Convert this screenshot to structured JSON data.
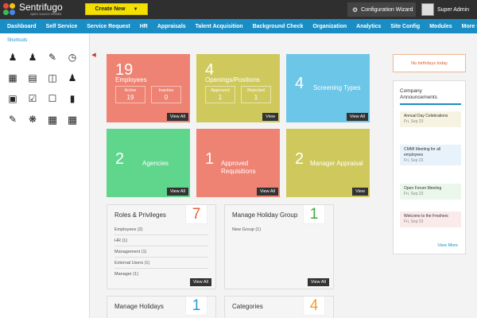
{
  "app": {
    "name": "Sentrifugo",
    "tagline": "open source HRMS",
    "create_label": "Create New",
    "config_label": "Configuration Wizard",
    "user_label": "Super Admin"
  },
  "nav": [
    "Dashboard",
    "Self Service",
    "Service Request",
    "HR",
    "Appraisals",
    "Talent Acquisition",
    "Background Check",
    "Organization",
    "Analytics",
    "Site Config",
    "Modules",
    "More ▾"
  ],
  "sidebar": {
    "title": "Shortcuts",
    "icons": [
      "user-add-icon",
      "user-settings-icon",
      "user-edit-icon",
      "schedule-icon",
      "calendar-icon",
      "document-list-icon",
      "id-card-icon",
      "team-icon",
      "monitor-check-icon",
      "checklist-icon",
      "file-check-icon",
      "ruler-icon",
      "form-edit-icon",
      "gear-icon",
      "grid-icon",
      "grid-icon-2"
    ]
  },
  "tiles": {
    "employees": {
      "count": "19",
      "label": "Employees",
      "active_label": "Active",
      "active_value": "19",
      "inactive_label": "Inactive",
      "inactive_value": "0",
      "action": "View All",
      "color": "#ee8273"
    },
    "openings": {
      "count": "4",
      "label": "Openings/Positions",
      "approved_label": "Approved",
      "approved_value": "1",
      "rejected_label": "Rejected",
      "rejected_value": "1",
      "action": "View",
      "color": "#cfc95d"
    },
    "screening": {
      "count": "4",
      "label": "Screening Types",
      "action": "View All",
      "color": "#6cc6e8"
    },
    "agencies": {
      "count": "2",
      "label": "Agencies",
      "action": "View All",
      "color": "#5fd68c"
    },
    "requisitions": {
      "count": "1",
      "label_line1": "Approved",
      "label_line2": "Requisitions",
      "action": "View All",
      "color": "#ee8273"
    },
    "appraisal": {
      "count": "2",
      "label": "Manager Appraisal",
      "action": "View",
      "color": "#cfc95d"
    }
  },
  "panels": {
    "roles": {
      "title": "Roles & Privileges",
      "count": "7",
      "count_color": "#e8603c",
      "items": [
        "Employees (2)",
        "HR (1)",
        "Management (1)",
        "External Users (1)",
        "Manager (1)"
      ],
      "action": "View All"
    },
    "holiday_group": {
      "title": "Manage Holiday Group",
      "count": "1",
      "count_color": "#3fa842",
      "items": [
        "New Group (1)"
      ],
      "action": "View All"
    },
    "holidays": {
      "title": "Manage Holidays",
      "count": "1",
      "count_color": "#2a9fd8"
    },
    "categories": {
      "title": "Categories",
      "count": "4",
      "count_color": "#f0a030"
    }
  },
  "right": {
    "birthday_text": "No birthdays today",
    "announcements_title": "Company Announcements",
    "announcements": [
      {
        "title": "Annual Day Celebrations",
        "date": "Fri, Sep 23",
        "bg": "#f7f3e2"
      },
      {
        "title": "CMMI Meeting for all employees",
        "date": "Fri, Sep 23",
        "bg": "#e7f2fa"
      },
      {
        "title": "Open Forum Meeting",
        "date": "Fri, Sep 23",
        "bg": "#eaf7ea"
      },
      {
        "title": "Welcome to the Freshers",
        "date": "Fri, Sep 23",
        "bg": "#fbeaea"
      }
    ],
    "view_more": "View More"
  }
}
